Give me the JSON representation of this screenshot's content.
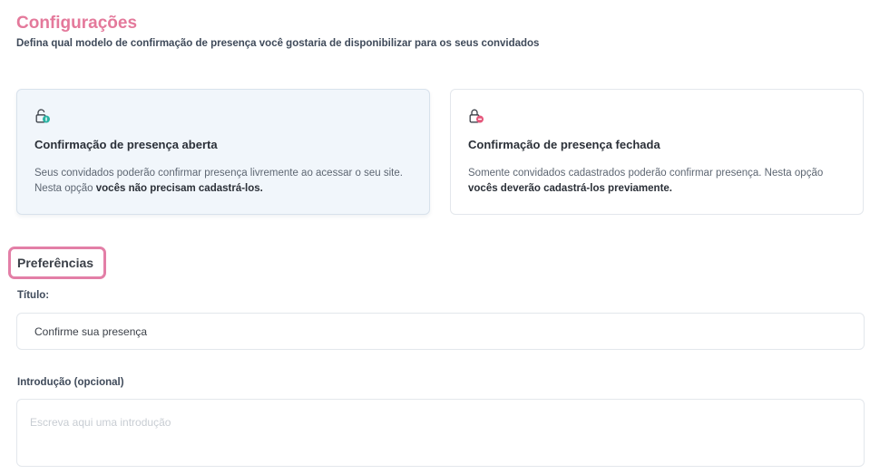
{
  "header": {
    "title": "Configurações",
    "subtitle": "Defina qual modelo de confirmação de presença você gostaria de disponibilizar para os seus convidados"
  },
  "options": [
    {
      "icon": "lock-open-badge-icon",
      "title": "Confirmação de presença aberta",
      "desc_plain": "Seus convidados poderão confirmar presença livremente ao acessar o seu site. Nesta opção ",
      "desc_bold": "vocês não precisam cadastrá-los.",
      "selected": true,
      "badge_color": "#2bb3a3"
    },
    {
      "icon": "lock-closed-badge-icon",
      "title": "Confirmação de presença fechada",
      "desc_plain": "Somente convidados cadastrados poderão confirmar presença. Nesta opção ",
      "desc_bold": "vocês deverão cadastrá-los previamente.",
      "selected": false,
      "badge_color": "#e5577b"
    }
  ],
  "preferences": {
    "heading": "Preferências",
    "title_label": "Título:",
    "title_value": "Confirme sua presença",
    "intro_label": "Introdução (opcional)",
    "intro_placeholder": "Escreva aqui uma introdução",
    "intro_value": ""
  },
  "colors": {
    "accent": "#e4799b",
    "highlight_frame": "#e37fa7",
    "selected_card_bg": "#f1f6fb"
  }
}
